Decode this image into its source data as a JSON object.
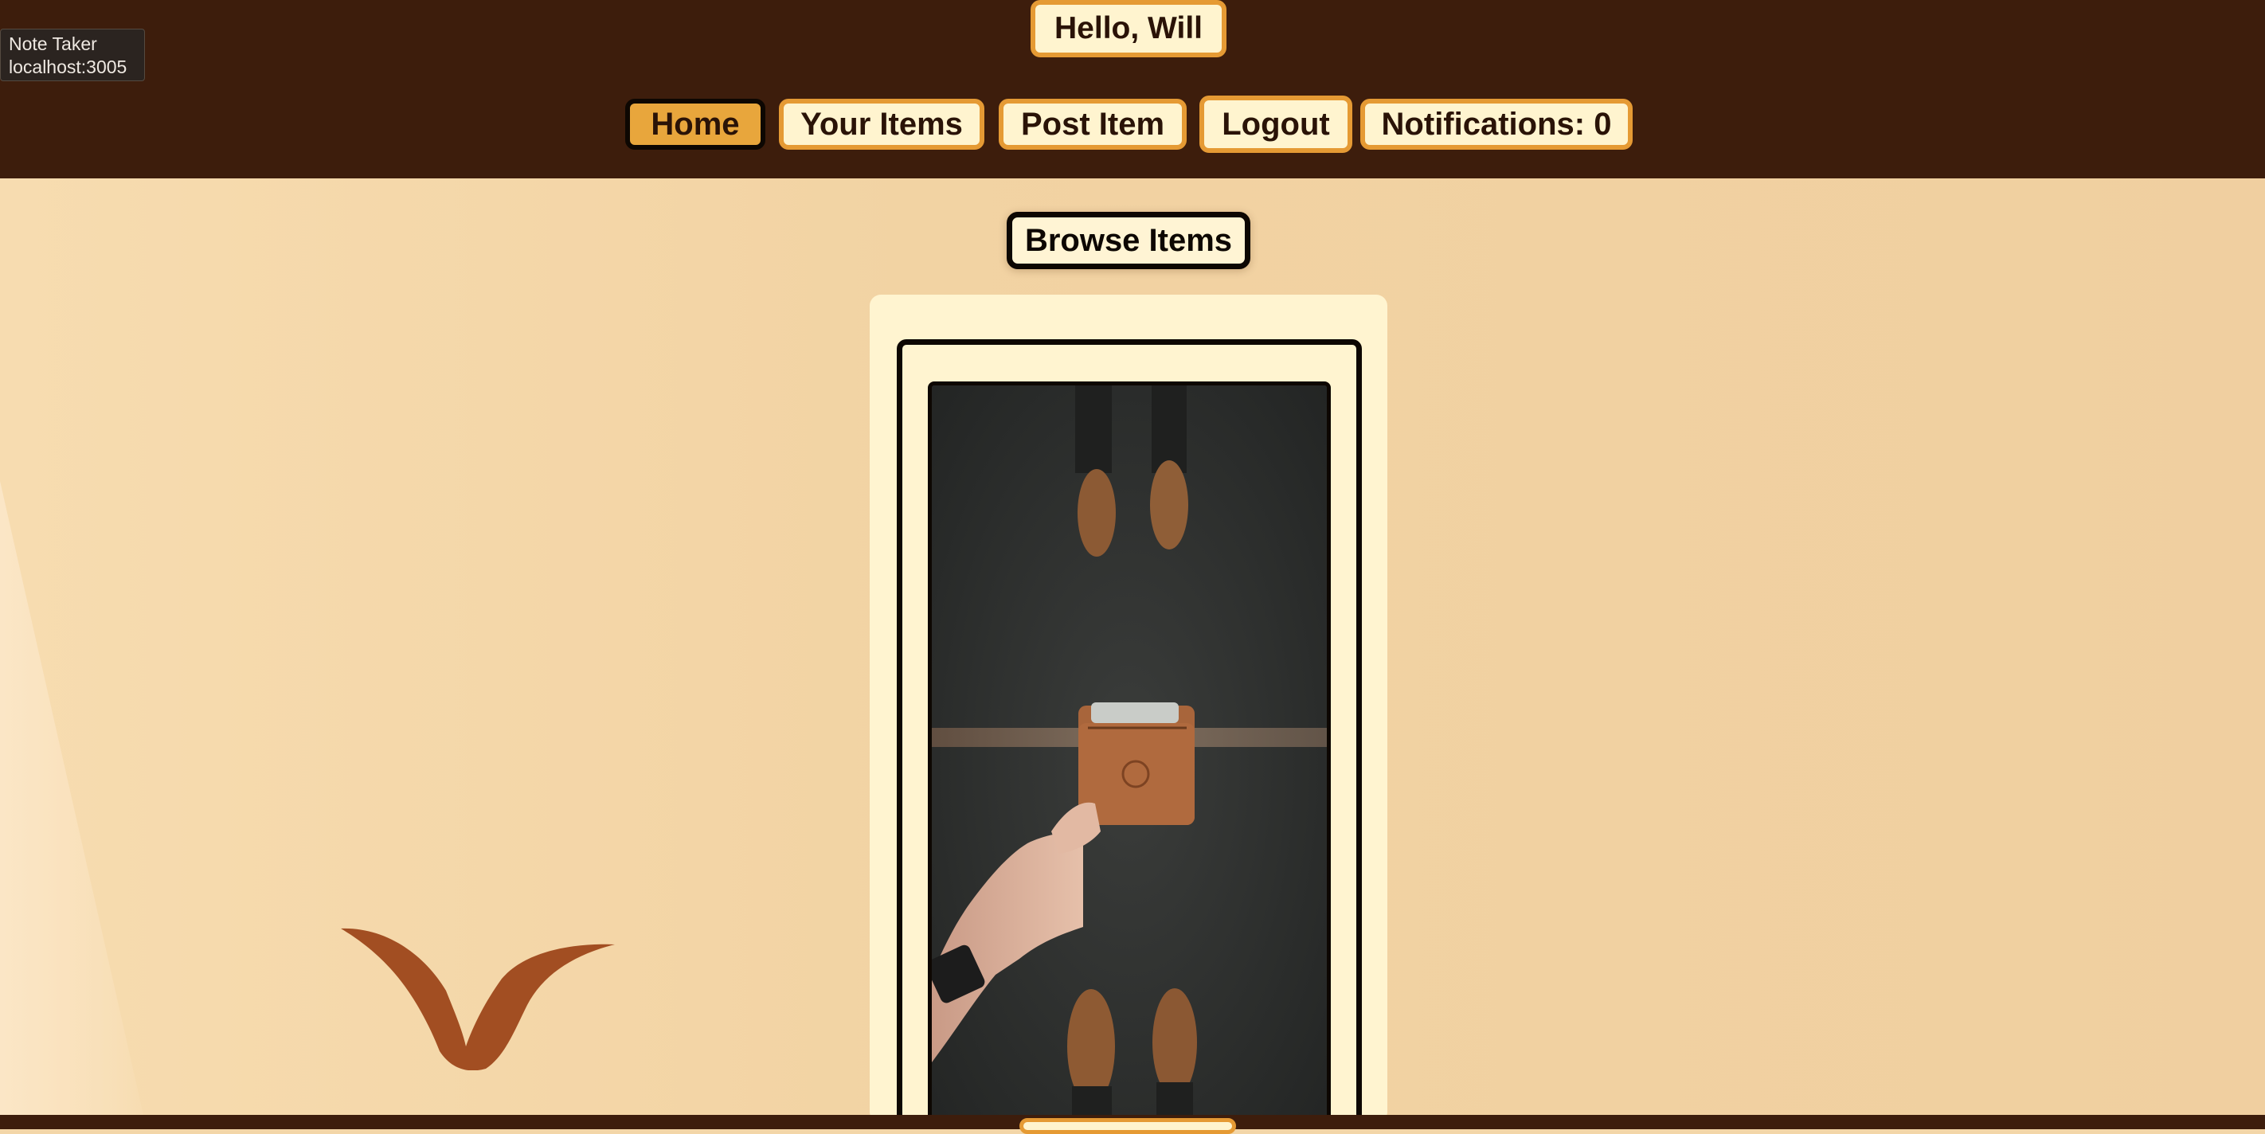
{
  "header": {
    "greeting": "Hello, Will",
    "nav": [
      {
        "label": "Home",
        "active": true
      },
      {
        "label": "Your Items",
        "active": false
      },
      {
        "label": "Post Item",
        "active": false
      },
      {
        "label": "Logout",
        "active": false
      },
      {
        "label": "Notifications: 0",
        "active": false
      }
    ]
  },
  "tooltip": {
    "title": "Note Taker",
    "url": "localhost:3005"
  },
  "main": {
    "title": "Browse Items",
    "item_image_icon": "wallet-photo"
  },
  "colors": {
    "header_bg": "#3d1d0c",
    "accent_orange": "#e59a34",
    "button_cream": "#fff4cf",
    "page_bg": "#f3d6a8",
    "logo_brown": "#a24e22"
  }
}
